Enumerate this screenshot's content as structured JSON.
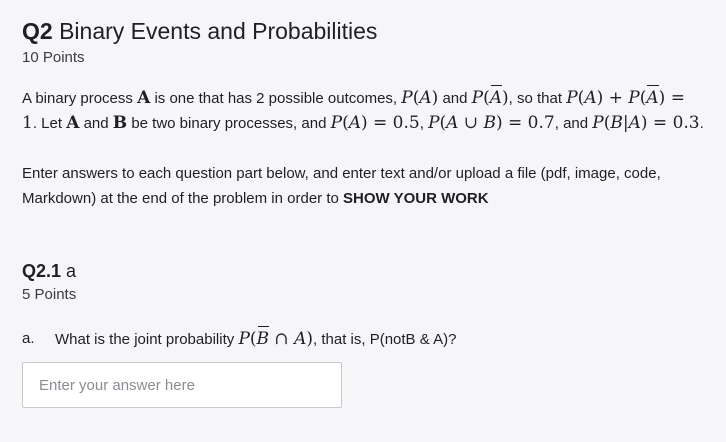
{
  "question": {
    "number": "Q2",
    "title": "Binary Events and Probabilities",
    "points": "10 Points",
    "intro": {
      "t1": "A binary process",
      "t2": "is one that has 2 possible outcomes,",
      "t3": "and",
      "t4": ", so that",
      "t5": ". Let",
      "t6": "and",
      "t7": "be two binary processes, and",
      "t8": ",",
      "t9": ", and",
      "t10": "."
    },
    "instructions": {
      "text": "Enter answers to each question part below, and enter text and/or upload a file (pdf, image, code, Markdown) at the end of the problem in order to",
      "emphasis": "SHOW YOUR WORK"
    }
  },
  "subquestion": {
    "number": "Q2.1",
    "title": "a",
    "points": "5 Points",
    "letter": "a.",
    "prompt_before": "What is the joint probability",
    "prompt_after": ", that is, P(notB & A)?",
    "answer_value": "",
    "answer_placeholder": "Enter your answer here"
  }
}
